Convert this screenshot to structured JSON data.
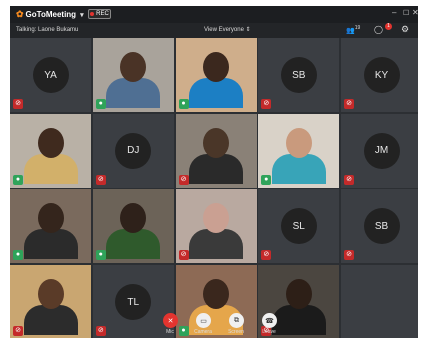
{
  "app": {
    "name": "GoToMeeting",
    "rec_label": "REC"
  },
  "subbar": {
    "talking": "Talking: Laone Bukamu",
    "view": "View Everyone",
    "attendee_count": "19",
    "chat_badge": "1"
  },
  "tiles": [
    {
      "initials": "YA",
      "video": false,
      "mic": "muted"
    },
    {
      "initials": "",
      "video": true,
      "mic": "live"
    },
    {
      "initials": "",
      "video": true,
      "mic": "live"
    },
    {
      "initials": "SB",
      "video": false,
      "mic": "muted"
    },
    {
      "initials": "KY",
      "video": false,
      "mic": "muted"
    },
    {
      "initials": "",
      "video": true,
      "mic": "live"
    },
    {
      "initials": "DJ",
      "video": false,
      "mic": "muted"
    },
    {
      "initials": "",
      "video": true,
      "mic": "muted"
    },
    {
      "initials": "",
      "video": true,
      "mic": "live"
    },
    {
      "initials": "JM",
      "video": false,
      "mic": "muted"
    },
    {
      "initials": "",
      "video": true,
      "mic": "live"
    },
    {
      "initials": "",
      "video": true,
      "mic": "live"
    },
    {
      "initials": "",
      "video": true,
      "mic": "muted"
    },
    {
      "initials": "SL",
      "video": false,
      "mic": "muted"
    },
    {
      "initials": "SB",
      "video": false,
      "mic": "muted"
    },
    {
      "initials": "",
      "video": true,
      "mic": "muted"
    },
    {
      "initials": "TL",
      "video": false,
      "mic": "muted"
    },
    {
      "initials": "",
      "video": true,
      "mic": "live"
    },
    {
      "initials": "",
      "video": true,
      "mic": "muted"
    },
    {
      "initials": "",
      "video": false,
      "mic": "none"
    }
  ],
  "controls": {
    "mic": "Mic",
    "camera": "Camera",
    "screen": "Screen",
    "leave": "Leave"
  },
  "colors": {
    "titlebar": "#1c1e21",
    "grid_bg": "#2c2f33",
    "tile_bg": "#3b3e43",
    "muted": "#c42a2a",
    "live": "#2fa35a",
    "brand": "#f58a1f"
  }
}
